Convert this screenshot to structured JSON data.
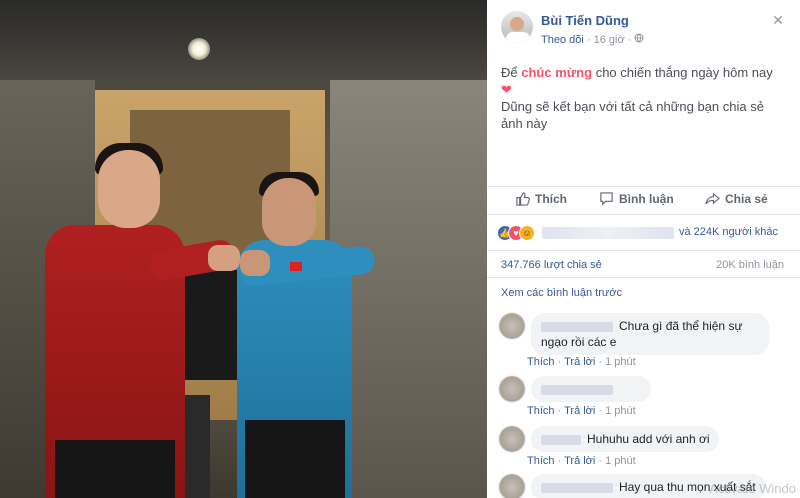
{
  "post": {
    "author": "Bùi Tiến Dũng",
    "follow": "Theo dõi",
    "time": "16 giờ",
    "globe_icon": "globe-icon",
    "text_pre": "Để",
    "text_highlight": "chúc mừng",
    "text_mid": "cho chiến thắng ngày hôm nay",
    "text_line2": "Dũng sẽ kết bạn với tất cả những bạn chia sẻ ảnh này",
    "highlight_color": "#f35369"
  },
  "actions": {
    "like": "Thích",
    "comment": "Bình luận",
    "share": "Chia sẻ"
  },
  "reactions": {
    "count_text": "và 224K người khác"
  },
  "stats": {
    "shares": "347.766 lượt chia sẻ",
    "comments": "20K bình luận"
  },
  "view_previous": "Xem các bình luận trước",
  "comments": [
    {
      "text": "Chưa gì đã thể hiện sự ngạo rồi các e",
      "like": "Thích",
      "reply": "Trả lời",
      "time": "1 phút"
    },
    {
      "text": "",
      "like": "Thích",
      "reply": "Trả lời",
      "time": "1 phút"
    },
    {
      "text": "Huhuhu add với anh ơi",
      "like": "Thích",
      "reply": "Trả lời",
      "time": "1 phút"
    },
    {
      "text": "Hay qua thu mọn xuất sắt",
      "like": "",
      "reply": "",
      "time": ""
    }
  ],
  "watermark": "Activate Windo",
  "colors": {
    "link": "#365899",
    "muted": "#90949c",
    "bubble": "#f2f3f5"
  }
}
